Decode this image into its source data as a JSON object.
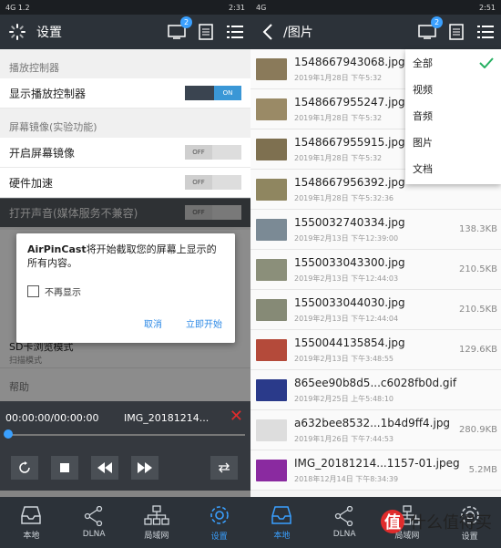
{
  "left": {
    "status": {
      "left": "4G 1.2",
      "right": "2:31"
    },
    "title": "设置",
    "badge": "2",
    "sections": [
      {
        "title": "播放控制器",
        "rows": [
          {
            "label": "显示播放控制器",
            "toggle": "ON"
          }
        ]
      },
      {
        "title": "屏幕镜像(实验功能)",
        "rows": [
          {
            "label": "开启屏幕镜像",
            "toggle": "OFF"
          },
          {
            "label": "硬件加速",
            "toggle": "OFF"
          },
          {
            "label": "打开声音(媒体服务不兼容)",
            "toggle": "OFF"
          }
        ]
      }
    ],
    "dialog": {
      "app": "AirPinCast",
      "message": "将开始截取您的屏幕上显示的所有内容。",
      "checkbox": "不再显示",
      "cancel": "取消",
      "start": "立即开始"
    },
    "sd_row": {
      "title": "SD卡浏览模式",
      "sub": "扫描模式"
    },
    "help_title": "帮助",
    "player": {
      "time": "00:00:00/00:00:00",
      "file": "IMG_20181214..."
    },
    "bottom_nav": [
      "本地",
      "DLNA",
      "局域网",
      "设置"
    ]
  },
  "right": {
    "status": {
      "left": "4G",
      "right": "2:51"
    },
    "title": "/图片",
    "badge": "2",
    "dropdown": [
      "全部",
      "视频",
      "音频",
      "图片",
      "文档"
    ],
    "files": [
      {
        "name": "1548667943068.jpg",
        "date": "2019年1月28日 下午5:32",
        "size": "",
        "color": "#8a7a5a"
      },
      {
        "name": "1548667955247.jpg",
        "date": "2019年1月28日 下午5:32",
        "size": "",
        "color": "#9a8a66"
      },
      {
        "name": "1548667955915.jpg",
        "date": "2019年1月28日 下午5:32",
        "size": "",
        "color": "#7e7050"
      },
      {
        "name": "1548667956392.jpg",
        "date": "2019年1月28日 下午5:32:36",
        "size": "",
        "color": "#8f8660"
      },
      {
        "name": "1550032740334.jpg",
        "date": "2019年2月13日 下午12:39:00",
        "size": "138.3KB",
        "color": "#7b8a95"
      },
      {
        "name": "1550033043300.jpg",
        "date": "2019年2月13日 下午12:44:03",
        "size": "210.5KB",
        "color": "#8b8f7a"
      },
      {
        "name": "1550033044030.jpg",
        "date": "2019年2月13日 下午12:44:04",
        "size": "210.5KB",
        "color": "#868a76"
      },
      {
        "name": "1550044135854.jpg",
        "date": "2019年2月13日 下午3:48:55",
        "size": "129.6KB",
        "color": "#b44a3a"
      },
      {
        "name": "865ee90b8d5...c6028fb0d.gif",
        "date": "2019年2月25日 上午5:48:10",
        "size": "",
        "color": "#2a3a8a"
      },
      {
        "name": "a632bee8532...1b4d9ff4.jpg",
        "date": "2019年1月26日 下午7:44:53",
        "size": "280.9KB",
        "color": "#dddddd"
      },
      {
        "name": "IMG_20181214...1157-01.jpeg",
        "date": "2018年12月14日 下午8:34:39",
        "size": "5.2MB",
        "color": "#8a2aa0"
      }
    ],
    "bottom_nav": [
      "本地",
      "DLNA",
      "局域网",
      "设置"
    ],
    "watermark": {
      "mark": "值",
      "text": "什么值得买"
    }
  }
}
